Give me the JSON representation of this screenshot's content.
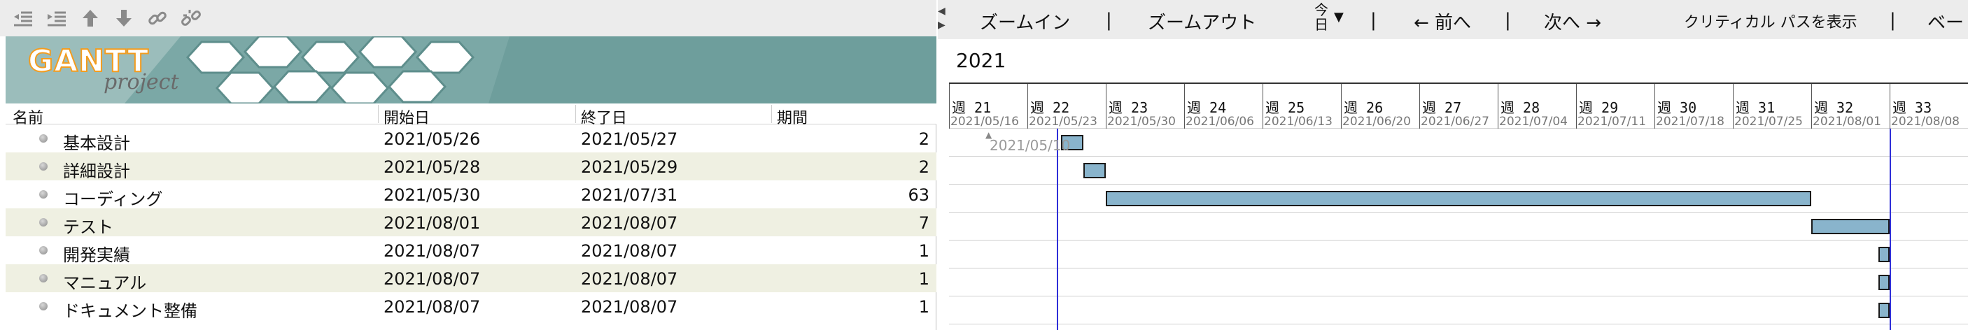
{
  "left_toolbar": {
    "icons": [
      "outdent-icon",
      "indent-icon",
      "move-up-icon",
      "move-down-icon",
      "link-icon",
      "unlink-icon"
    ]
  },
  "banner": {
    "logo_main": "GANTT",
    "logo_sub": "project",
    "colors": {
      "background": "#6e9e9c",
      "logo_outline": "#f39c1f"
    }
  },
  "table": {
    "headers": {
      "name": "名前",
      "start": "開始日",
      "end": "終了日",
      "duration": "期間"
    },
    "rows": [
      {
        "name": "基本設計",
        "start": "2021/05/26",
        "end": "2021/05/27",
        "duration": "2"
      },
      {
        "name": "詳細設計",
        "start": "2021/05/28",
        "end": "2021/05/29",
        "duration": "2"
      },
      {
        "name": "コーディング",
        "start": "2021/05/30",
        "end": "2021/07/31",
        "duration": "63"
      },
      {
        "name": "テスト",
        "start": "2021/08/01",
        "end": "2021/08/07",
        "duration": "7"
      },
      {
        "name": "開発実績",
        "start": "2021/08/07",
        "end": "2021/08/07",
        "duration": "1"
      },
      {
        "name": "マニュアル",
        "start": "2021/08/07",
        "end": "2021/08/07",
        "duration": "1"
      },
      {
        "name": "ドキュメント整備",
        "start": "2021/08/07",
        "end": "2021/08/07",
        "duration": "1"
      }
    ],
    "colors": {
      "alt_row": "#eff0e2"
    }
  },
  "chart_toolbar": {
    "zoom_in": "ズームイン",
    "zoom_out": "ズームアウト",
    "today": "今日",
    "prev": "← 前へ",
    "next": "次へ →",
    "critical_path": "クリティカル パスを表示",
    "baseline": "ベー",
    "separator": "|"
  },
  "timeline": {
    "year": "2021",
    "weeks": [
      {
        "label": "週 21",
        "date": "2021/05/16"
      },
      {
        "label": "週 22",
        "date": "2021/05/23"
      },
      {
        "label": "週 23",
        "date": "2021/05/30"
      },
      {
        "label": "週 24",
        "date": "2021/06/06"
      },
      {
        "label": "週 25",
        "date": "2021/06/13"
      },
      {
        "label": "週 26",
        "date": "2021/06/20"
      },
      {
        "label": "週 27",
        "date": "2021/06/27"
      },
      {
        "label": "週 28",
        "date": "2021/07/04"
      },
      {
        "label": "週 29",
        "date": "2021/07/11"
      },
      {
        "label": "週 30",
        "date": "2021/07/18"
      },
      {
        "label": "週 31",
        "date": "2021/07/25"
      },
      {
        "label": "週 32",
        "date": "2021/08/01"
      },
      {
        "label": "週 33",
        "date": "2021/08/08"
      }
    ],
    "today_date": "2021/05/10",
    "colors": {
      "bar_fill": "#89b4cc",
      "today_line": "#2f2fd8"
    }
  }
}
